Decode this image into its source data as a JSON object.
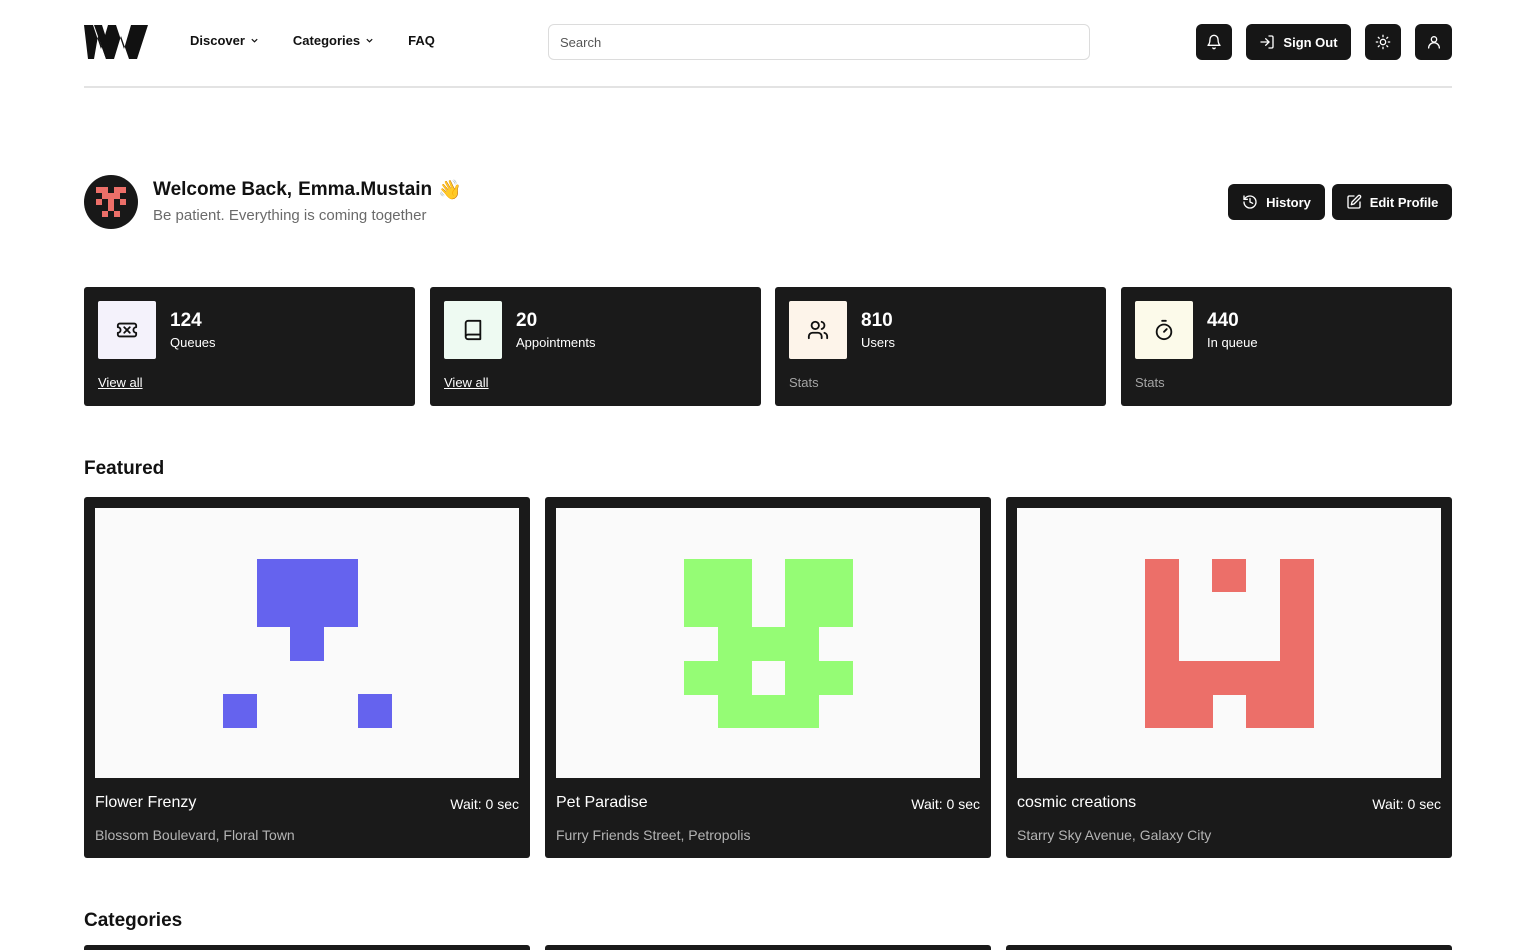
{
  "header": {
    "nav": [
      {
        "label": "Discover",
        "has_dropdown": true
      },
      {
        "label": "Categories",
        "has_dropdown": true
      },
      {
        "label": "FAQ",
        "has_dropdown": false
      }
    ],
    "search_placeholder": "Search",
    "buttons": {
      "notifications_icon": "bell-icon",
      "sign_out_label": "Sign Out",
      "theme_icon": "sun-icon",
      "profile_icon": "user-icon"
    }
  },
  "welcome": {
    "greeting": "Welcome Back,",
    "username": "Emma.Mustain",
    "emoji": "👋",
    "subtitle": "Be patient. Everything is coming together",
    "history_label": "History",
    "edit_profile_label": "Edit Profile"
  },
  "stats": [
    {
      "value": "124",
      "label": "Queues",
      "footer": "View all",
      "footer_is_link": true,
      "icon": "ticket-icon",
      "icon_bg": "#f4f2fb"
    },
    {
      "value": "20",
      "label": "Appointments",
      "footer": "View all",
      "footer_is_link": true,
      "icon": "book-icon",
      "icon_bg": "#eefaf2"
    },
    {
      "value": "810",
      "label": "Users",
      "footer": "Stats",
      "footer_is_link": false,
      "icon": "users-icon",
      "icon_bg": "#fdf4ea"
    },
    {
      "value": "440",
      "label": "In queue",
      "footer": "Stats",
      "footer_is_link": false,
      "icon": "timer-icon",
      "icon_bg": "#fcfaea"
    }
  ],
  "featured": {
    "title": "Featured",
    "items": [
      {
        "name": "Flower Frenzy",
        "wait": "Wait: 0 sec",
        "address": "Blossom Boulevard, Floral Town",
        "color": "#6563ee"
      },
      {
        "name": "Pet Paradise",
        "wait": "Wait: 0 sec",
        "address": "Furry Friends Street, Petropolis",
        "color": "#95fc75"
      },
      {
        "name": "cosmic creations",
        "wait": "Wait: 0 sec",
        "address": "Starry Sky Avenue, Galaxy City",
        "color": "#ec6f69"
      }
    ]
  },
  "categories": {
    "title": "Categories"
  },
  "colors": {
    "dark": "#1a1a1a",
    "avatar_accent": "#ec6f69"
  }
}
